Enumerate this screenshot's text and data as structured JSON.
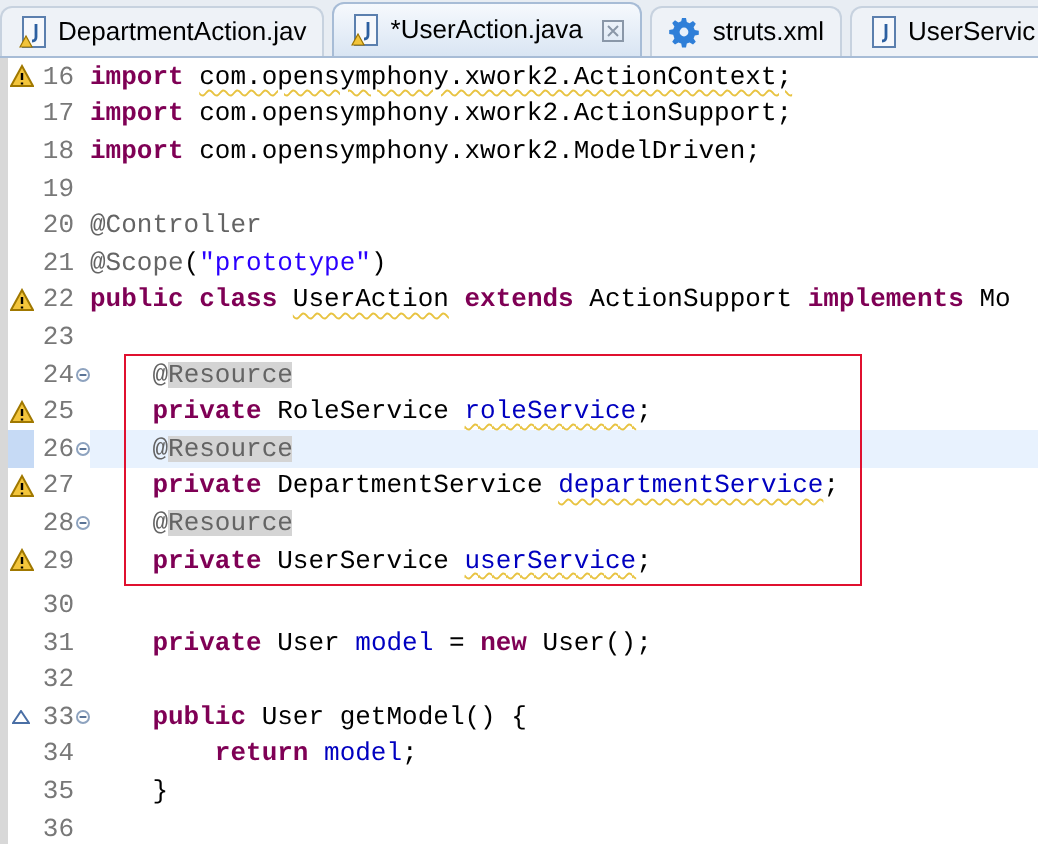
{
  "tabs": [
    {
      "label": "DepartmentAction.jav",
      "kind": "java",
      "warning": true,
      "selected": false
    },
    {
      "label": "*UserAction.java",
      "kind": "java",
      "warning": true,
      "selected": true
    },
    {
      "label": "struts.xml",
      "kind": "xml",
      "warning": false,
      "selected": false
    },
    {
      "label": "UserServic",
      "kind": "java",
      "warning": false,
      "selected": false
    }
  ],
  "lines_before": [
    {
      "number": "16",
      "warning": true,
      "tokens": [
        {
          "kind": "keyword",
          "text": "import "
        },
        {
          "kind": "plain",
          "text": "com.opensymphony.xwork2.ActionContext;",
          "warned": true
        }
      ]
    },
    {
      "number": "17",
      "tokens": [
        {
          "kind": "keyword",
          "text": "import "
        },
        {
          "kind": "plain",
          "text": "com.opensymphony.xwork2.ActionSupport;"
        }
      ]
    },
    {
      "number": "18",
      "tokens": [
        {
          "kind": "keyword",
          "text": "import "
        },
        {
          "kind": "plain",
          "text": "com.opensymphony.xwork2.ModelDriven;"
        }
      ]
    },
    {
      "number": "19"
    },
    {
      "number": "20",
      "tokens": [
        {
          "kind": "annotation",
          "text": "@Controller"
        }
      ]
    },
    {
      "number": "21",
      "tokens": [
        {
          "kind": "annotation",
          "text": "@Scope"
        },
        {
          "kind": "plain",
          "text": "("
        },
        {
          "kind": "string",
          "text": "\"prototype\""
        },
        {
          "kind": "plain",
          "text": ")"
        }
      ]
    },
    {
      "number": "22",
      "warning": true,
      "tokens": [
        {
          "kind": "keyword",
          "text": "public class "
        },
        {
          "kind": "plain",
          "text": "UserAction",
          "warned": true
        },
        {
          "kind": "keyword",
          "text": " extends "
        },
        {
          "kind": "plain",
          "text": "ActionSupport "
        },
        {
          "kind": "keyword",
          "text": "implements "
        },
        {
          "kind": "plain",
          "text": "Mo"
        }
      ]
    },
    {
      "number": "23"
    }
  ],
  "framed_lines": [
    {
      "number": "24",
      "foldable": true,
      "tokens": [
        {
          "kind": "annotation",
          "text": "    @"
        },
        {
          "kind": "annotation",
          "text": "Resource",
          "marked": true
        }
      ]
    },
    {
      "number": "25",
      "warning": true,
      "tokens": [
        {
          "kind": "keyword",
          "text": "    private "
        },
        {
          "kind": "plain",
          "text": "RoleService "
        },
        {
          "kind": "field",
          "text": "roleService",
          "warned": true
        },
        {
          "kind": "plain",
          "text": ";"
        }
      ]
    },
    {
      "number": "26",
      "foldable": true,
      "current": true,
      "tokens": [
        {
          "kind": "annotation",
          "text": "    @"
        },
        {
          "kind": "annotation",
          "text": "Resource",
          "marked": true
        }
      ]
    },
    {
      "number": "27",
      "warning": true,
      "tokens": [
        {
          "kind": "keyword",
          "text": "    private "
        },
        {
          "kind": "plain",
          "text": "DepartmentService "
        },
        {
          "kind": "field",
          "text": "departmentService",
          "warned": true
        },
        {
          "kind": "plain",
          "text": ";"
        }
      ]
    },
    {
      "number": "28",
      "foldable": true,
      "tokens": [
        {
          "kind": "annotation",
          "text": "    @"
        },
        {
          "kind": "annotation",
          "text": "Resource",
          "marked": true
        }
      ]
    },
    {
      "number": "29",
      "warning": true,
      "tokens": [
        {
          "kind": "keyword",
          "text": "    private "
        },
        {
          "kind": "plain",
          "text": "UserService "
        },
        {
          "kind": "field",
          "text": "userService",
          "warned": true
        },
        {
          "kind": "plain",
          "text": ";"
        }
      ]
    }
  ],
  "lines_after": [
    {
      "number": "30"
    },
    {
      "number": "31",
      "tokens": [
        {
          "kind": "keyword",
          "text": "    private "
        },
        {
          "kind": "plain",
          "text": "User "
        },
        {
          "kind": "field",
          "text": "model"
        },
        {
          "kind": "plain",
          "text": " = "
        },
        {
          "kind": "keyword",
          "text": "new "
        },
        {
          "kind": "plain",
          "text": "User();"
        }
      ]
    },
    {
      "number": "32"
    },
    {
      "number": "33",
      "override": true,
      "foldable": true,
      "tokens": [
        {
          "kind": "keyword",
          "text": "    public "
        },
        {
          "kind": "plain",
          "text": "User getModel() {"
        }
      ]
    },
    {
      "number": "34",
      "tokens": [
        {
          "kind": "keyword",
          "text": "        return "
        },
        {
          "kind": "field",
          "text": "model"
        },
        {
          "kind": "plain",
          "text": ";"
        }
      ]
    },
    {
      "number": "35",
      "tokens": [
        {
          "kind": "plain",
          "text": "    }"
        }
      ]
    },
    {
      "number": "36"
    }
  ]
}
